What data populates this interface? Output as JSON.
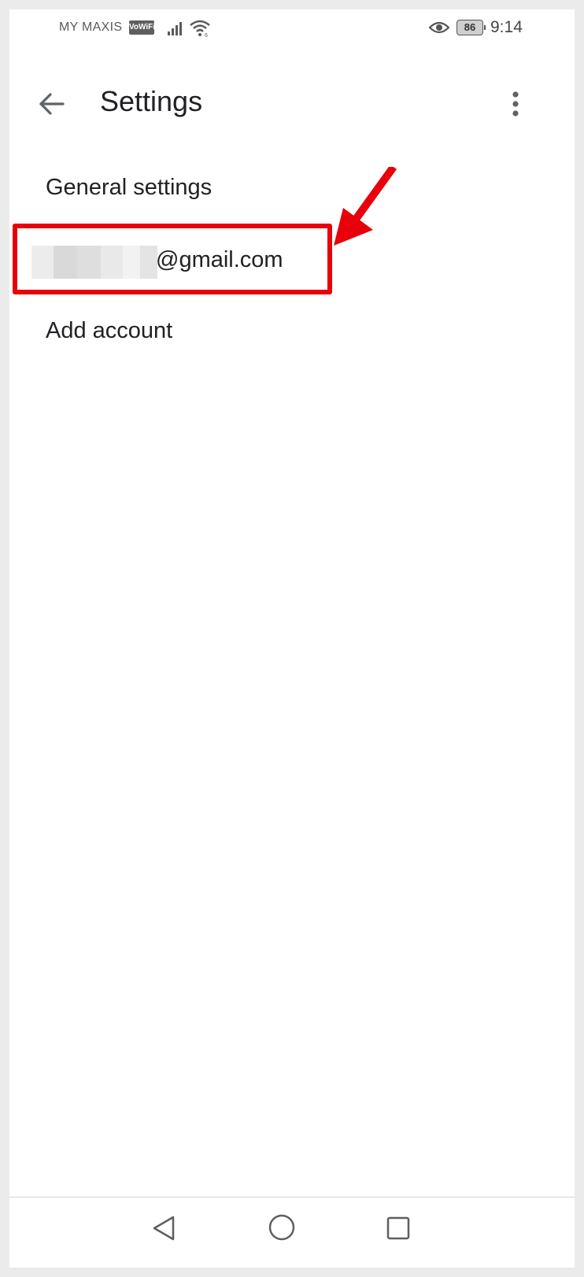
{
  "status_bar": {
    "carrier": "MY MAXIS",
    "vowifi_badge": "VoWiFi",
    "battery_level": "86",
    "time": "9:14"
  },
  "app_bar": {
    "title": "Settings",
    "back_icon": "arrow-back-icon",
    "menu_icon": "more-vert-icon"
  },
  "settings_list": {
    "items": [
      {
        "label": "General settings"
      },
      {
        "label": "@gmail.com",
        "redacted_prefix": true
      },
      {
        "label": "Add account"
      }
    ]
  },
  "annotation": {
    "highlight_color": "#e8000b"
  },
  "nav_bar": {
    "back_icon": "triangle-back-icon",
    "home_icon": "circle-home-icon",
    "recents_icon": "square-recents-icon"
  }
}
